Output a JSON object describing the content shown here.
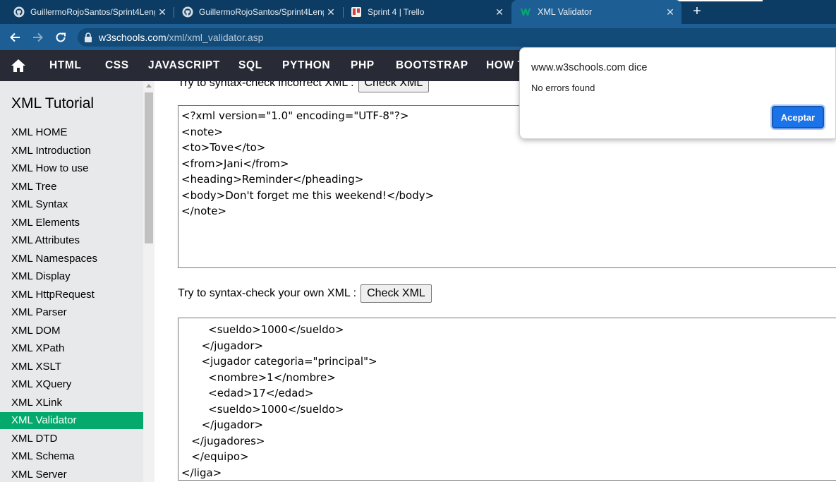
{
  "browser": {
    "tabs": [
      {
        "title": "GuillermoRojoSantos/Sprint4Leng",
        "icon": "github-icon",
        "active": false
      },
      {
        "title": "GuillermoRojoSantos/Sprint4Leng",
        "icon": "github-icon",
        "active": false
      },
      {
        "title": "Sprint 4 | Trello",
        "icon": "trello-icon",
        "active": false
      },
      {
        "title": "XML Validator",
        "icon": "w3schools-icon",
        "active": true
      }
    ],
    "new_tab": "+",
    "url_host": "w3schools.com",
    "url_path": "/xml/xml_validator.asp"
  },
  "topnav": {
    "items": [
      "HTML",
      "CSS",
      "JAVASCRIPT",
      "SQL",
      "PYTHON",
      "PHP",
      "BOOTSTRAP",
      "HOW TO"
    ]
  },
  "sidebar": {
    "title": "XML Tutorial",
    "items": [
      "XML HOME",
      "XML Introduction",
      "XML How to use",
      "XML Tree",
      "XML Syntax",
      "XML Elements",
      "XML Attributes",
      "XML Namespaces",
      "XML Display",
      "XML HttpRequest",
      "XML Parser",
      "XML DOM",
      "XML XPath",
      "XML XSLT",
      "XML XQuery",
      "XML XLink",
      "XML Validator",
      "XML DTD",
      "XML Schema",
      "XML Server"
    ],
    "active_index": 16
  },
  "main": {
    "incorrect_label": "Try to syntax-check incorrect XML :",
    "own_label": "Try to syntax-check your own XML :",
    "check_button": "Check XML",
    "incorrect_xml_lines": [
      "<?xml version=\"1.0\" encoding=\"UTF-8\"?>",
      "<note>",
      "<to>Tove</to>",
      "<from>Jani</from>",
      "<heading>Reminder</pheading>",
      "<body>Don't forget me this weekend!</body>",
      "</note>"
    ],
    "own_xml_lines": [
      "        <sueldo>1000</sueldo>",
      "      </jugador>",
      "      <jugador categoria=\"principal\">",
      "        <nombre>1</nombre>",
      "        <edad>17</edad>",
      "        <sueldo>1000</sueldo>",
      "      </jugador>",
      "   </jugadores>",
      "   </equipo>",
      "</liga>"
    ]
  },
  "dialog": {
    "title": "www.w3schools.com dice",
    "message": "No errors found",
    "ok_label": "Aceptar"
  },
  "colors": {
    "w3_green": "#04aa6d",
    "w3_nav_bg": "#282a35",
    "browser_frame": "#1d5f95",
    "dialog_button": "#1a73e8"
  }
}
